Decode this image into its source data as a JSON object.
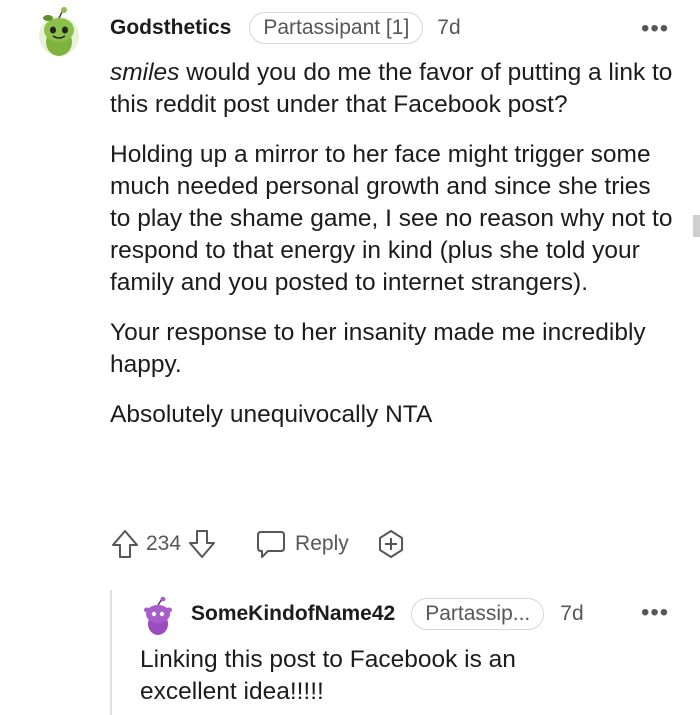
{
  "comment": {
    "username": "Godsthetics",
    "flair": "Partassipant [1]",
    "age": "7d",
    "body": {
      "p1_em": "smiles",
      "p1_rest": " would you do me the favor of putting a link to this reddit post under that Facebook post?",
      "p2": "Holding up a mirror to her face might trigger some much needed personal growth and since she tries to play the shame game, I see no reason why not to respond to that energy in kind (plus she told your family and you posted to internet strangers).",
      "p3": "Your response to her insanity made me incredibly happy.",
      "p4": "Absolutely unequivocally NTA"
    },
    "votes": "234",
    "reply_label": "Reply",
    "icons": [
      "snoo-avatar-green",
      "more-icon",
      "upvote-icon",
      "downvote-icon",
      "reply-icon",
      "award-icon"
    ]
  },
  "reply_comment": {
    "username": "SomeKindofName42",
    "flair": "Partassip...",
    "age": "7d",
    "body": "Linking this post to Facebook is an excellent idea!!!!!",
    "icons": [
      "snoo-avatar-purple",
      "more-icon"
    ]
  },
  "colors": {
    "text": "#1c1c1c",
    "meta": "#575757",
    "border": "#d7d7d7",
    "avatar_green": "#7fb23e",
    "avatar_purple": "#9b4dbf"
  }
}
